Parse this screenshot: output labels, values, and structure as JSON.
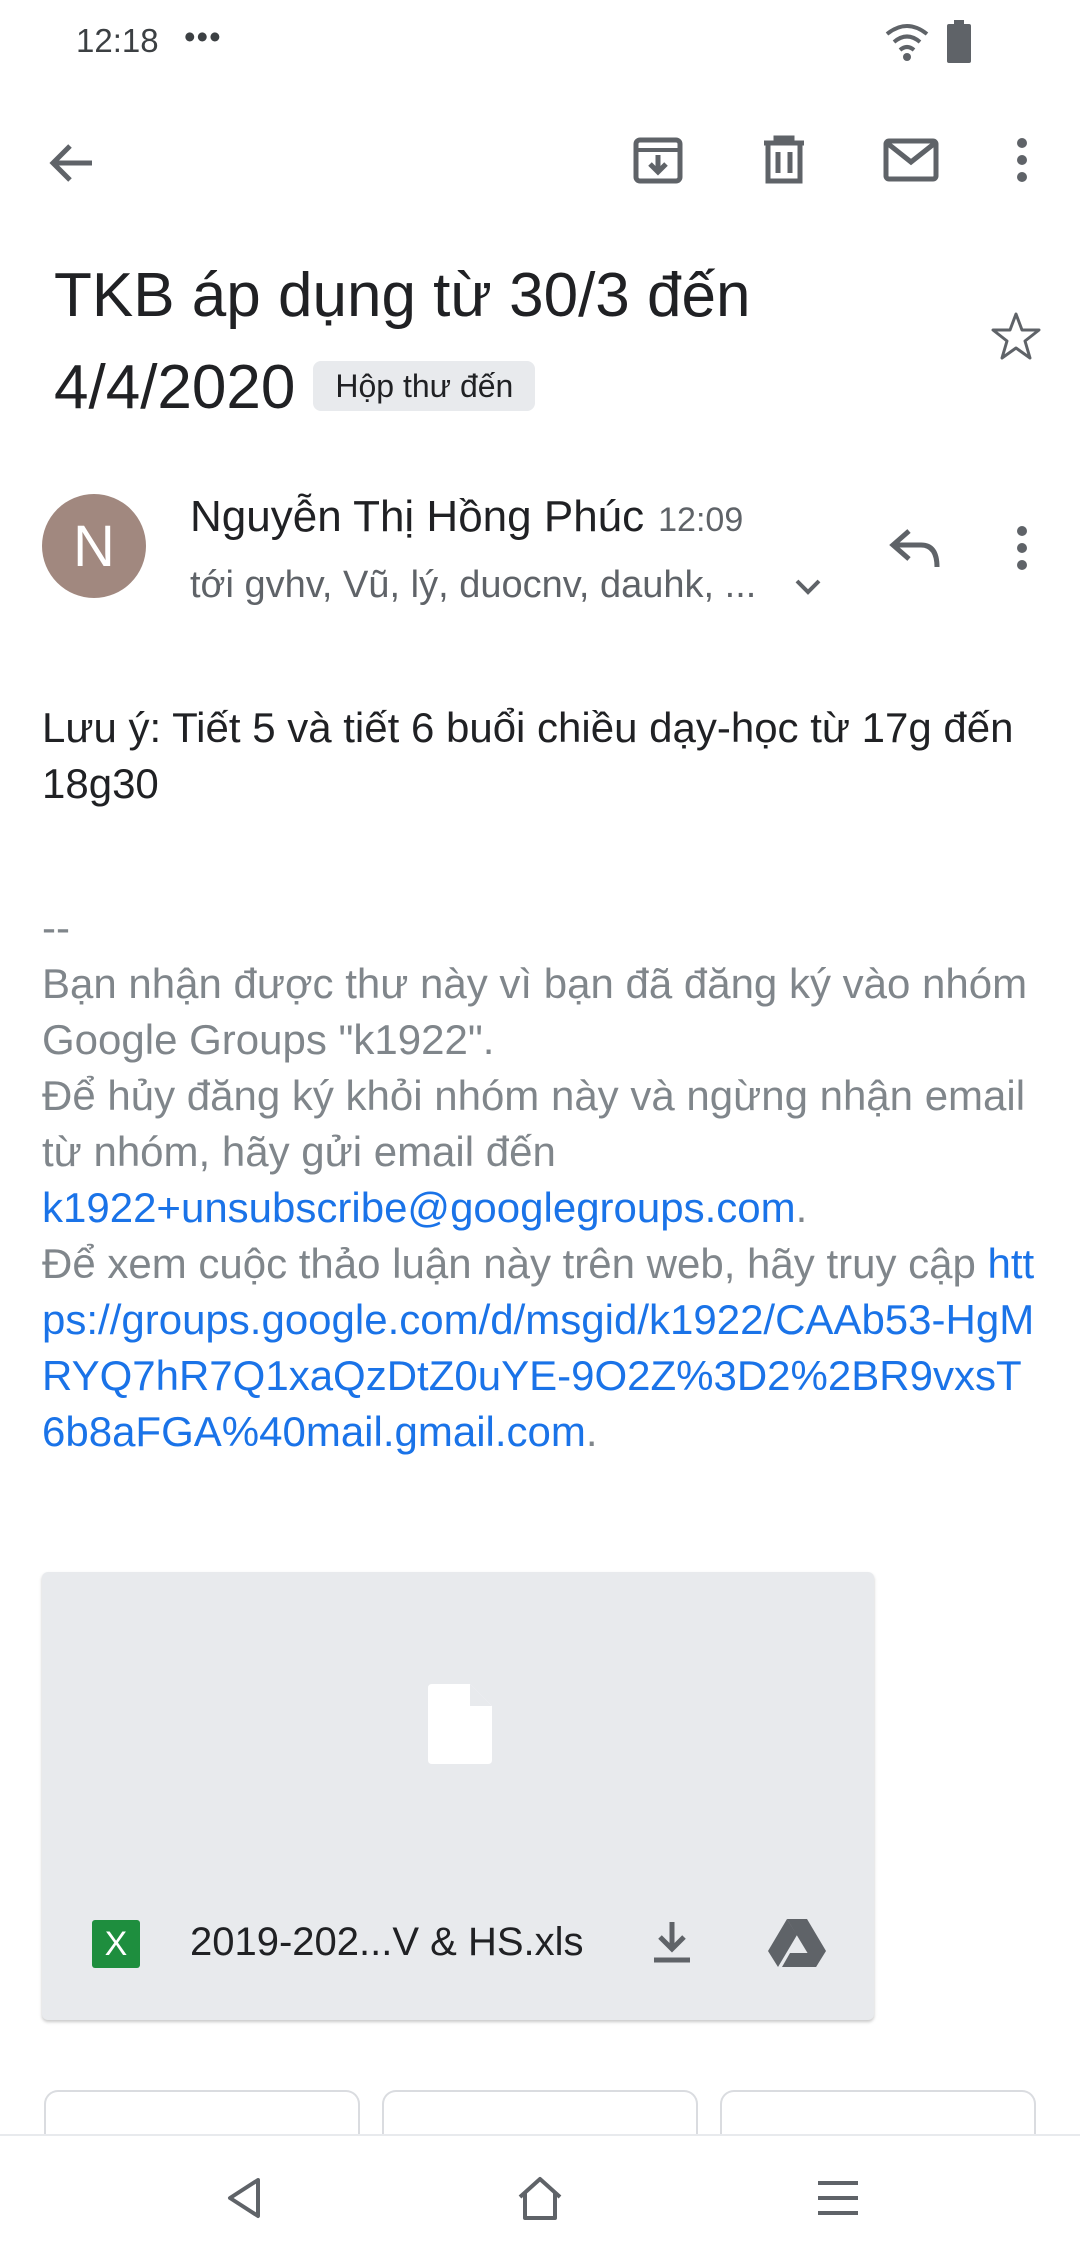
{
  "status_bar": {
    "time": "12:18",
    "dots": "•••"
  },
  "toolbar": {
    "back": "back-arrow-icon",
    "archive": "archive-icon",
    "delete": "trash-icon",
    "mark_unread": "mail-icon",
    "more": "more-vert-icon"
  },
  "email": {
    "subject": "TKB áp dụng từ 30/3 đến 4/4/2020",
    "label": "Hộp thư đến",
    "sender_initial": "N",
    "sender_name": "Nguyễn Thị Hồng Phúc",
    "time": "12:09",
    "recipients": "tới gvhv, Vũ, lý, duocnv, dauhk, ...",
    "body_line": "Lưu ý: Tiết 5 và tiết 6 buổi chiều dạy-học từ 17g đến 18g30",
    "separator": "--",
    "footer_1": "Bạn nhận được thư này vì bạn đã đăng ký vào nhóm Google Groups \"k1922\".",
    "footer_2": "Để hủy đăng ký khỏi nhóm này và ngừng nhận email từ nhóm, hãy gửi email đến",
    "unsubscribe_link": "k1922+unsubscribe@googlegroups.com",
    "period": ".",
    "footer_3": "Để xem cuộc thảo luận này trên web, hãy truy cập",
    "web_link": "https://groups.google.com/d/msgid/k1922/CAAb53-HgMRYQ7hR7Q1xaQzDtZ0uYE-9O2Z%3D2%2BR9vxsT6b8aFGA%40mail.gmail.com"
  },
  "attachment": {
    "file_name": "2019-202...V & HS.xls",
    "type_badge": "X"
  },
  "colors": {
    "link": "#1a73e8",
    "avatar": "#a1887f",
    "xls_green": "#1e8e3e"
  }
}
